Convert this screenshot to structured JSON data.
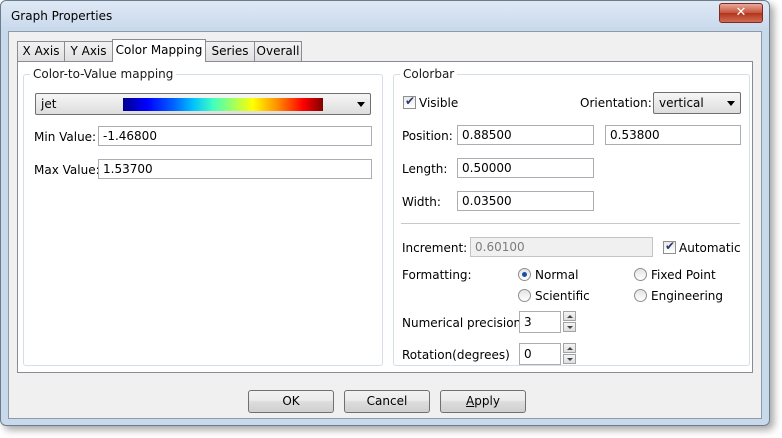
{
  "window": {
    "title": "Graph Properties",
    "close_glyph": "✕"
  },
  "tabs": [
    "X Axis",
    "Y Axis",
    "Color Mapping",
    "Series",
    "Overall"
  ],
  "active_tab": "Color Mapping",
  "color_mapping": {
    "group_title": "Color-to-Value mapping",
    "colormap": "jet",
    "min_label": "Min Value:",
    "min_value": "-1.46800",
    "max_label": "Max Value:",
    "max_value": "1.53700"
  },
  "colorbar": {
    "group_title": "Colorbar",
    "visible_label": "Visible",
    "visible_checked": true,
    "orientation_label": "Orientation:",
    "orientation_value": "vertical",
    "position_label": "Position:",
    "position_x": "0.88500",
    "position_y": "0.53800",
    "length_label": "Length:",
    "length_value": "0.50000",
    "width_label": "Width:",
    "width_value": "0.03500",
    "increment_label": "Increment:",
    "increment_value": "0.60100",
    "automatic_label": "Automatic",
    "automatic_checked": true,
    "formatting_label": "Formatting:",
    "formatting_options": [
      "Normal",
      "Fixed Point",
      "Scientific",
      "Engineering"
    ],
    "formatting_selected": "Normal",
    "precision_label": "Numerical precision",
    "precision_value": "3",
    "rotation_label": "Rotation(degrees)",
    "rotation_value": "0"
  },
  "buttons": {
    "ok": "OK",
    "cancel": "Cancel",
    "apply": "Apply"
  },
  "colors": {
    "accent": "#1d4fa0",
    "close_red": "#c6523a"
  }
}
